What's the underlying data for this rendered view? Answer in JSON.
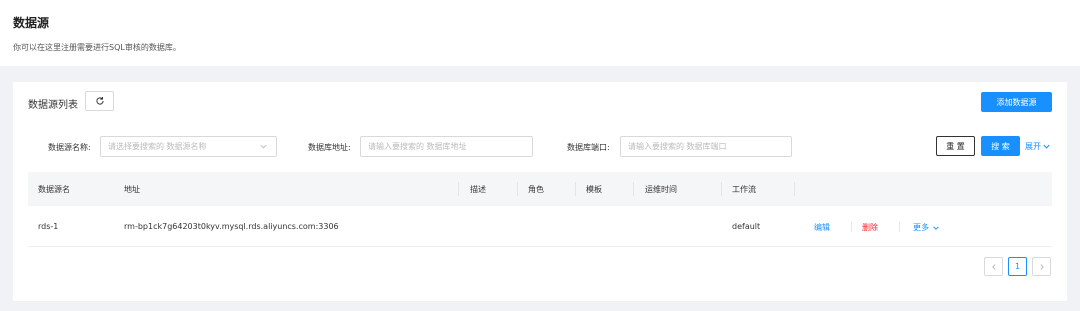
{
  "header": {
    "title": "数据源",
    "description": "你可以在这里注册需要进行SQL审核的数据库。"
  },
  "list": {
    "title": "数据源列表",
    "add_button": "添加数据源"
  },
  "filters": {
    "name_label": "数据源名称:",
    "name_placeholder": "请选择要搜索的 数据源名称",
    "address_label": "数据库地址:",
    "address_placeholder": "请输入要搜索的 数据库地址",
    "port_label": "数据库端口:",
    "port_placeholder": "请输入要搜索的 数据库端口",
    "reset_button": "重 置",
    "search_button": "搜 索",
    "expand_link": "展开"
  },
  "table": {
    "columns": [
      "数据源名",
      "地址",
      "描述",
      "角色",
      "模板",
      "运维时间",
      "工作流"
    ],
    "rows": [
      {
        "name": "rds-1",
        "address": "rm-bp1ck7g64203t0kyv.mysql.rds.aliyuncs.com:3306",
        "description": "",
        "role": "",
        "template": "",
        "maintenance": "",
        "workflow": "default",
        "actions": {
          "edit": "编辑",
          "delete": "删除",
          "more": "更多"
        }
      }
    ]
  },
  "pagination": {
    "current_page": "1"
  },
  "colors": {
    "primary": "#1890ff",
    "danger": "#f5222d",
    "background": "#f0f2f5"
  },
  "icons": [
    "refresh-icon",
    "chevron-down-icon",
    "chevron-left-icon",
    "chevron-right-icon"
  ]
}
